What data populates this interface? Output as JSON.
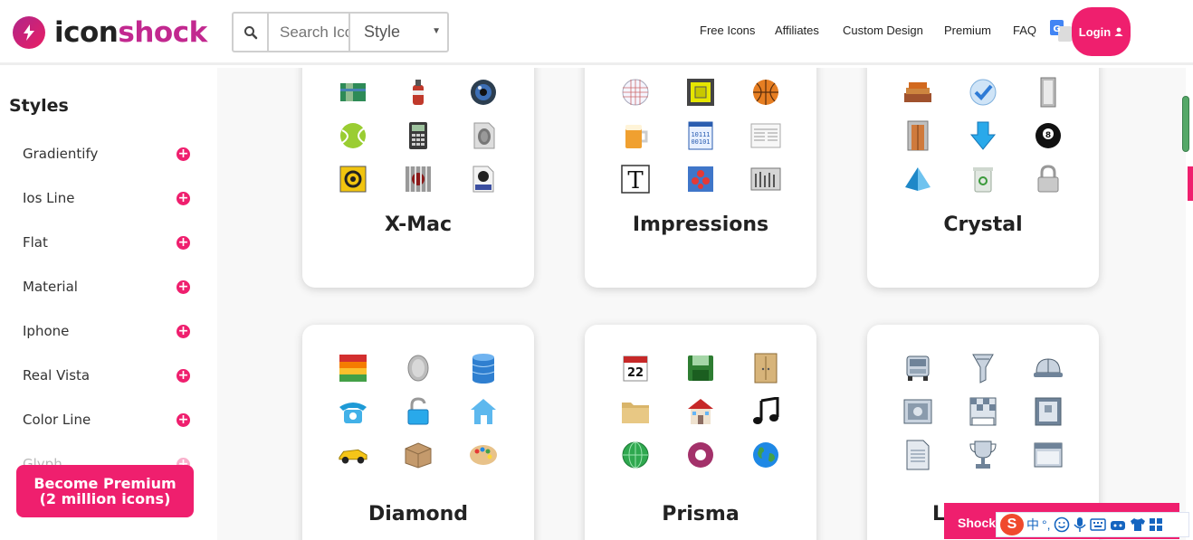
{
  "header": {
    "logo_part1": "icon",
    "logo_part2": "shock",
    "search": {
      "placeholder": "Search Icons",
      "style_label": "Style"
    },
    "nav": [
      "Free Icons",
      "Affiliates",
      "Custom Design",
      "Premium",
      "FAQ"
    ],
    "login_label": "Login"
  },
  "sidebar": {
    "title": "Styles",
    "items": [
      "Gradientify",
      "Ios Line",
      "Flat",
      "Material",
      "Iphone",
      "Real Vista",
      "Color Line",
      "Glyph"
    ],
    "premium_line1": "Become Premium",
    "premium_line2": "(2 million icons)"
  },
  "cards": [
    {
      "title": "X-Mac",
      "icons": [
        "map-icon",
        "spray-can-icon",
        "speaker-icon",
        "tennis-ball-icon",
        "calculator-icon",
        "fingerprint-icon",
        "biohazard-icon",
        "jail-icon",
        "wmv-file-icon"
      ]
    },
    {
      "title": "Impressions",
      "icons": [
        "globe-grid-icon",
        "monitor-icon",
        "basketball-icon",
        "beer-mug-icon",
        "binary-file-icon",
        "newspaper-icon",
        "font-t-icon",
        "molecule-icon",
        "equalizer-icon"
      ]
    },
    {
      "title": "Crystal",
      "icons": [
        "bricks-icon",
        "checkmark-badge-icon",
        "glass-panel-icon",
        "door-icon",
        "download-arrow-icon",
        "eight-ball-icon",
        "pyramid-icon",
        "recycle-bin-icon",
        "padlock-icon"
      ]
    },
    {
      "title": "Diamond",
      "icons": [
        "layers-icon",
        "coin-icon",
        "database-icon",
        "telephone-icon",
        "unlock-icon",
        "home-icon",
        "sports-car-icon",
        "package-icon",
        "palette-icon"
      ]
    },
    {
      "title": "Prisma",
      "icons": [
        "calendar-icon",
        "floppy-disk-icon",
        "cabinet-icon",
        "folder-icon",
        "house-icon",
        "music-note-icon",
        "green-globe-icon",
        "record-icon",
        "earth-icon"
      ]
    },
    {
      "title": "L",
      "icons": [
        "truck-icon",
        "funnel-icon",
        "hard-hat-icon",
        "photo-icon",
        "chess-icon",
        "frame-icon",
        "document-icon",
        "trophy-icon",
        "window-icon"
      ]
    }
  ],
  "bottom": {
    "shock_label": "ShockFa",
    "ime_chars": [
      "中",
      "°,"
    ],
    "ime_logo": "S"
  },
  "google_badge": "G",
  "colors": {
    "accent": "#ef1f6e",
    "logo_purple": "#c2288f"
  }
}
